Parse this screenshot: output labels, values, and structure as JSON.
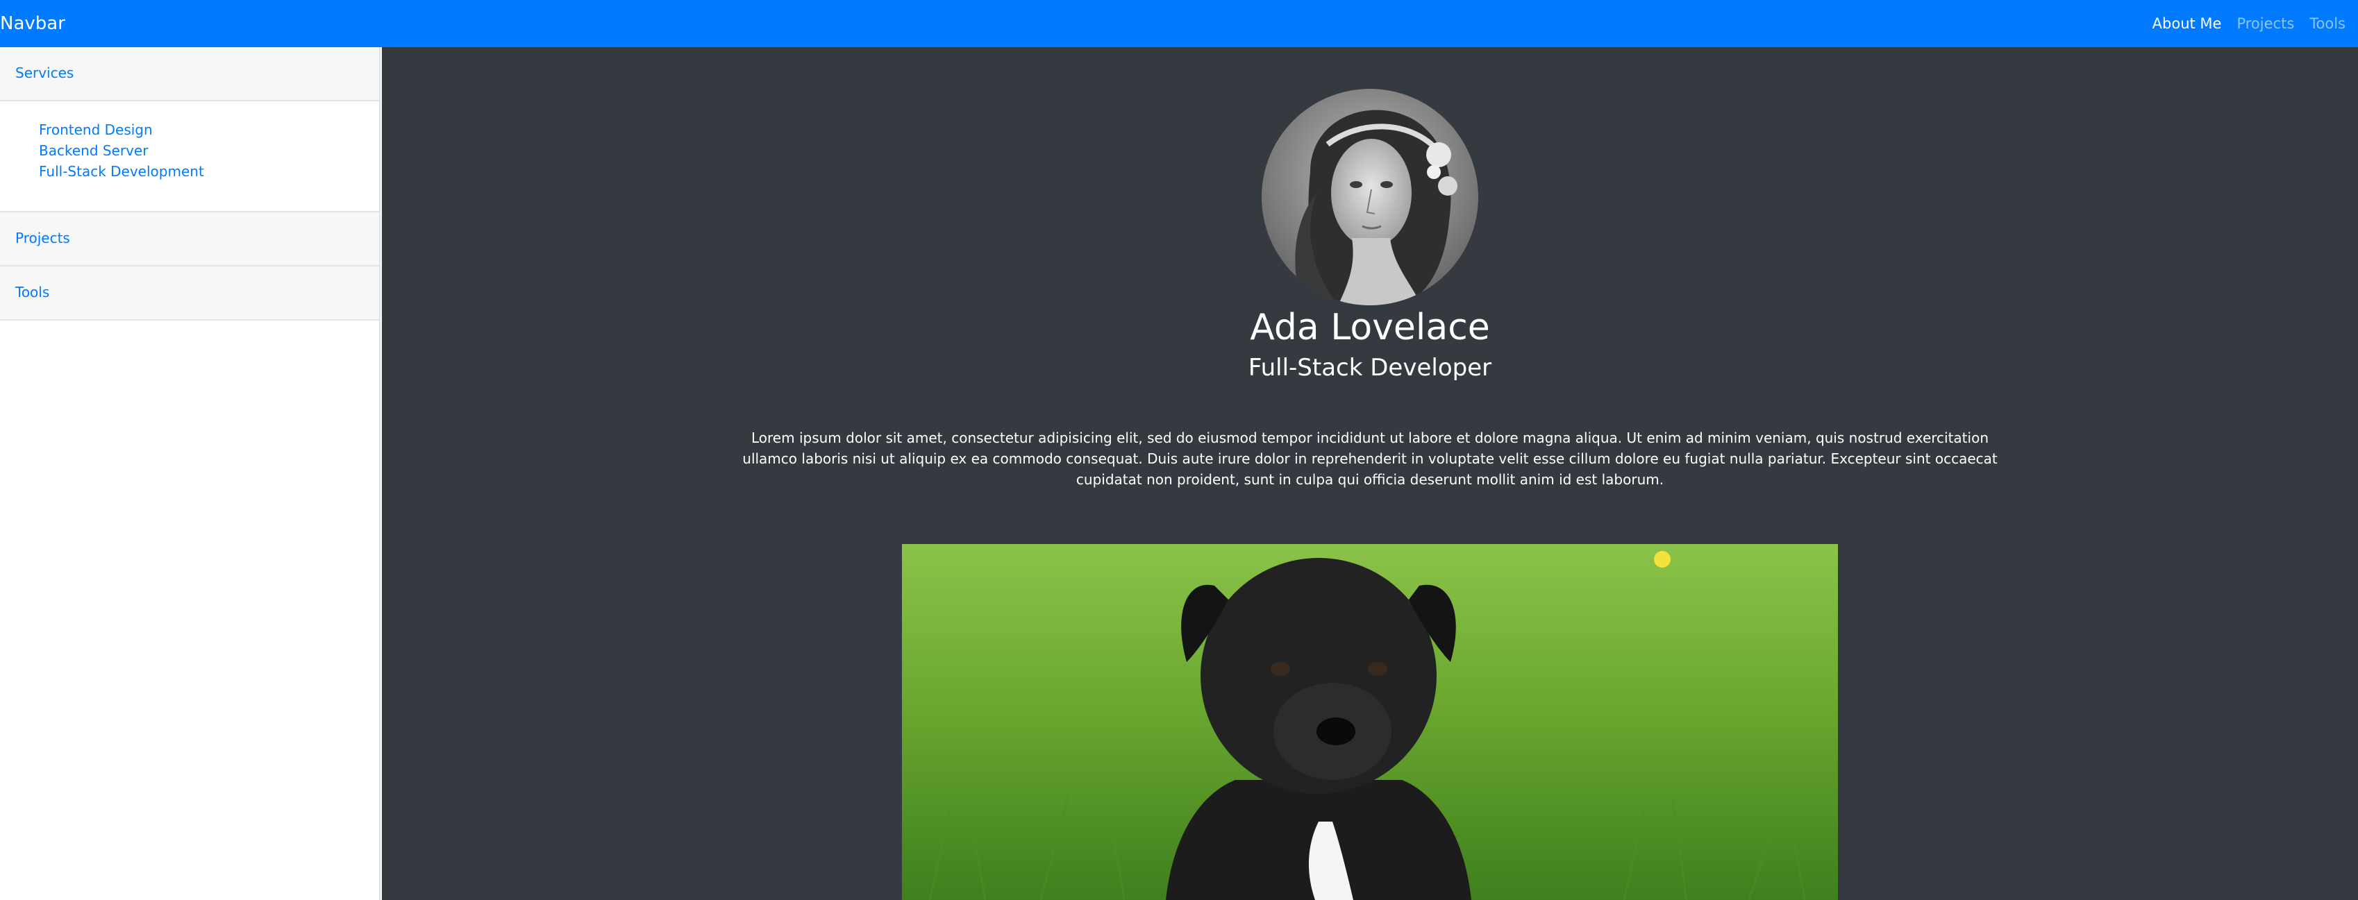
{
  "navbar": {
    "brand": "Navbar",
    "links": [
      "About Me",
      "Projects",
      "Tools"
    ]
  },
  "sidebar": {
    "services_label": "Services",
    "services_items": [
      "Frontend Design",
      "Backend Server",
      "Full-Stack Development"
    ],
    "projects_label": "Projects",
    "tools_label": "Tools"
  },
  "profile": {
    "name": "Ada Lovelace",
    "role": "Full-Stack Developer",
    "bio": "Lorem ipsum dolor sit amet, consectetur adipisicing elit, sed do eiusmod tempor incididunt ut labore et dolore magna aliqua. Ut enim ad minim veniam, quis nostrud exercitation ullamco laboris nisi ut aliquip ex ea commodo consequat. Duis aute irure dolor in reprehenderit in voluptate velit esse cillum dolore eu fugiat nulla pariatur. Excepteur sint occaecat cupidatat non proident, sunt in culpa qui officia deserunt mollit anim id est laborum."
  },
  "colors": {
    "navbar": "#007bff",
    "link": "#007bff",
    "main_bg": "#343a40"
  }
}
